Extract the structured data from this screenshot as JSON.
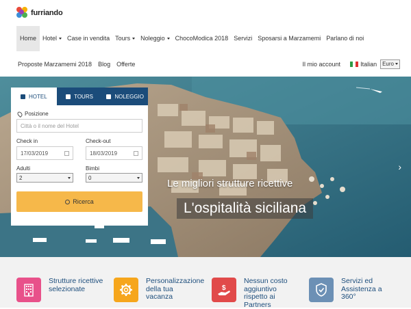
{
  "brand": {
    "name": "furriando"
  },
  "nav": {
    "row1": [
      {
        "label": "Home",
        "active": true,
        "dropdown": false
      },
      {
        "label": "Hotel",
        "dropdown": true
      },
      {
        "label": "Case in vendita",
        "dropdown": false
      },
      {
        "label": "Tours",
        "dropdown": true
      },
      {
        "label": "Noleggio",
        "dropdown": true
      },
      {
        "label": "ChocoModica 2018",
        "dropdown": false
      },
      {
        "label": "Servizi",
        "dropdown": false
      },
      {
        "label": "Sposarsi a Marzamemi",
        "dropdown": false
      },
      {
        "label": "Parlano di noi",
        "dropdown": false
      }
    ],
    "row2": [
      {
        "label": "Proposte Marzamemi 2018"
      },
      {
        "label": "Blog"
      },
      {
        "label": "Offerte"
      }
    ],
    "account": "Il mio account",
    "language": "Italian",
    "currency": "Euro"
  },
  "search": {
    "tabs": [
      {
        "label": "HOTEL",
        "icon": "hotel-icon"
      },
      {
        "label": "TOURS",
        "icon": "bus-icon"
      },
      {
        "label": "NOLEGGIO",
        "icon": "car-icon"
      }
    ],
    "position_label": "Posizione",
    "position_placeholder": "Città o il nome del Hotel",
    "checkin_label": "Check in",
    "checkin_value": "17/03/2019",
    "checkout_label": "Check-out",
    "checkout_value": "18/03/2019",
    "adults_label": "Adulti",
    "adults_value": "2",
    "children_label": "Bimbi",
    "children_value": "0",
    "submit_label": "Ricerca"
  },
  "hero": {
    "subtitle": "Le migliori strutture ricettive",
    "title": "L'ospitalità siciliana",
    "next_icon": "chevron-right-icon"
  },
  "features": [
    {
      "text": "Strutture ricettive selezionate",
      "icon": "building-icon",
      "color": "#e8518a"
    },
    {
      "text": "Personalizzazione della tua vacanza",
      "icon": "gear-icon",
      "color": "#f6a61c"
    },
    {
      "text": "Nessun costo aggiuntivo rispetto ai Partners",
      "icon": "money-hand-icon",
      "color": "#e14a4a"
    },
    {
      "text": "Servizi ed Assistenza a 360°",
      "icon": "shield-icon",
      "color": "#6c90b5"
    }
  ],
  "colors": {
    "nav_tab_bg": "#1b4c7a",
    "button": "#f6b84a",
    "feature_text": "#1c4d7c"
  }
}
